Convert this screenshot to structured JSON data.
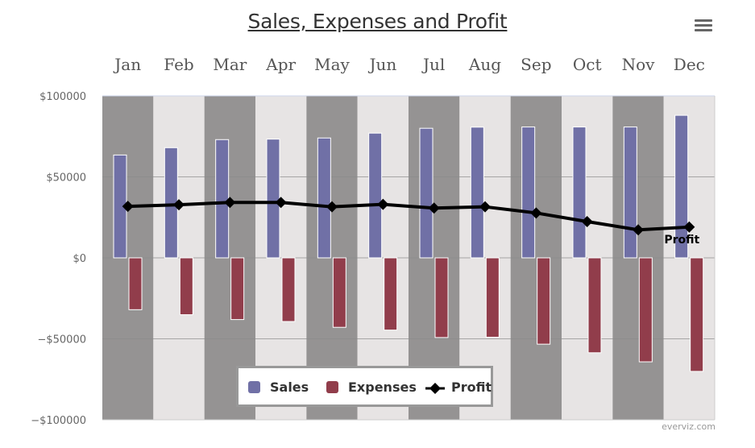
{
  "chart_data": {
    "type": "bar",
    "title": "Sales, Expenses and Profit",
    "xlabel": "",
    "ylabel": "",
    "categories": [
      "Jan",
      "Feb",
      "Mar",
      "Apr",
      "May",
      "Jun",
      "Jul",
      "Aug",
      "Sep",
      "Oct",
      "Nov",
      "Dec"
    ],
    "x_axis_position": "top",
    "ylim": [
      -100000,
      100000
    ],
    "y_ticks": [
      100000,
      50000,
      0,
      -50000,
      -100000
    ],
    "y_tick_labels": [
      "$100000",
      "$50000",
      "$0",
      "−$50000",
      "−$100000"
    ],
    "grid": true,
    "alternate_band_colors": [
      "#959393",
      "#e7e4e4"
    ],
    "series": [
      {
        "name": "Sales",
        "type": "column",
        "color": "#7070a6",
        "values": [
          63500,
          68000,
          73000,
          73300,
          74000,
          77000,
          80000,
          80700,
          80800,
          80800,
          80800,
          88000
        ]
      },
      {
        "name": "Expenses",
        "type": "column",
        "color": "#913d4b",
        "values": [
          -32000,
          -35100,
          -38100,
          -39300,
          -42900,
          -44600,
          -49200,
          -49000,
          -53300,
          -58600,
          -64200,
          -70100
        ]
      },
      {
        "name": "Profit",
        "type": "line",
        "color": "#000000",
        "marker": "diamond",
        "values": [
          31800,
          32800,
          34200,
          34200,
          31500,
          33000,
          30700,
          31500,
          27700,
          22400,
          17300,
          19000
        ],
        "end_label": "Profit"
      }
    ],
    "legend": {
      "position": "bottom-center",
      "items": [
        "Sales",
        "Expenses",
        "Profit"
      ]
    }
  },
  "menu": {
    "icon": "hamburger-menu-icon"
  },
  "credits": "everviz.com"
}
